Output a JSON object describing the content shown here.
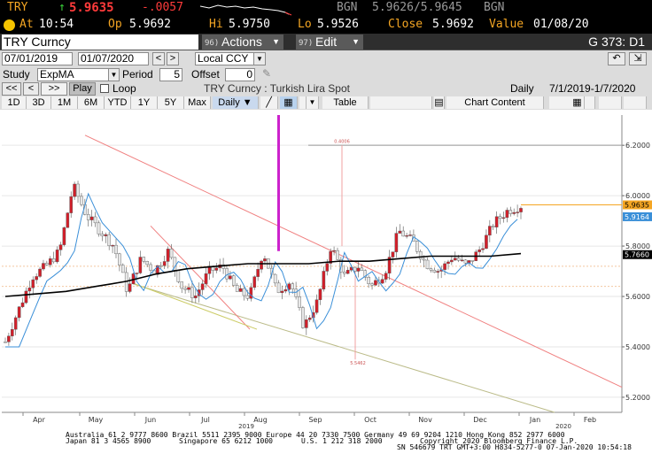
{
  "quote": {
    "ticker": "TRY",
    "arrow": "↑",
    "last": "5.9635",
    "change": "-.0057",
    "bid_ccy": "BGN",
    "bid_ask": "5.9626/5.9645",
    "ask_ccy": "BGN"
  },
  "ohlc": {
    "at_label": "At",
    "time": "10:54",
    "open_label": "Op",
    "open": "5.9692",
    "high_label": "Hi",
    "high": "5.9750",
    "low_label": "Lo",
    "low": "5.9526",
    "close_label": "Close",
    "close": "5.9692",
    "value_label": "Value",
    "value_date": "01/08/20"
  },
  "titlebar": {
    "security": "TRY Curncy",
    "actions_num": "96)",
    "actions_label": "Actions",
    "edit_num": "97)",
    "edit_label": "Edit",
    "page": "G 373: D1"
  },
  "dates": {
    "start": "07/01/2019",
    "end": "01/07/2020",
    "prev": "<",
    "next": ">",
    "currency": "Local CCY"
  },
  "study": {
    "label": "Study",
    "value": "ExpMA",
    "period_label": "Period",
    "period": "5",
    "offset_label": "Offset",
    "offset": "0"
  },
  "nav": {
    "rew": "<<",
    "back": "<",
    "fwd": ">>",
    "play": "Play",
    "loop": "Loop",
    "security_desc": "TRY Curncy : Turkish Lira Spot",
    "freq": "Daily",
    "range": "7/1/2019-1/7/2020"
  },
  "periods": {
    "buttons": [
      "1D",
      "3D",
      "1M",
      "6M",
      "YTD",
      "1Y",
      "5Y",
      "Max"
    ],
    "freq": "Daily ▼",
    "table": "Table",
    "chart_content": "Chart Content"
  },
  "chart_data": {
    "type": "candlestick",
    "x_labels": [
      "Apr",
      "May",
      "Jun",
      "Jul",
      "Aug",
      "Sep",
      "Oct",
      "Nov",
      "Dec",
      "Jan",
      "Feb"
    ],
    "year_labels": [
      "2019",
      "2020"
    ],
    "y_ticks": [
      "6.2000",
      "6.0000",
      "5.8000",
      "5.6000",
      "5.4000",
      "5.2000"
    ],
    "ylim": [
      5.14,
      6.32
    ],
    "price_tags": [
      "5.9635",
      "5.9164",
      "5.7660"
    ],
    "annotations": [
      "0.4006",
      "5.5462"
    ],
    "colors": {
      "up": "#e8e8e8",
      "down": "#d21f2a",
      "spike": "#cc22cc",
      "ma_long": "#000000",
      "ma_short": "#3a8fd8",
      "channel": "#f08080"
    },
    "moving_average_long": [
      5.6,
      5.61,
      5.62,
      5.64,
      5.66,
      5.69,
      5.71,
      5.72,
      5.73,
      5.73,
      5.73,
      5.74,
      5.74,
      5.75,
      5.76,
      5.76,
      5.76,
      5.77
    ],
    "close_series": [
      5.42,
      5.55,
      5.68,
      5.72,
      5.78,
      6.04,
      5.92,
      5.86,
      5.8,
      5.62,
      5.75,
      5.7,
      5.78,
      5.64,
      5.6,
      5.7,
      5.72,
      5.62,
      5.6,
      5.78,
      5.62,
      5.66,
      5.48,
      5.58,
      5.8,
      5.68,
      5.72,
      5.64,
      5.7,
      5.86,
      5.82,
      5.73,
      5.7,
      5.76,
      5.72,
      5.79,
      5.89,
      5.94,
      5.96
    ]
  },
  "footer": {
    "line1": "Australia 61 2 9777 8600 Brazil 5511 2395 9000 Europe 44 20 7330 7500 Germany 49 69 9204 1210 Hong Kong 852 2977 6000",
    "line2a": "Japan 81 3 4565 8900",
    "line2b": "Singapore 65 6212 1000",
    "line2c": "U.S. 1 212 318 2000",
    "line2d": "Copyright 2020 Bloomberg Finance L.P.",
    "line3": "SN 546679 TRT  GMT+3:00 H834-5277-0 07-Jan-2020 10:54:18"
  }
}
